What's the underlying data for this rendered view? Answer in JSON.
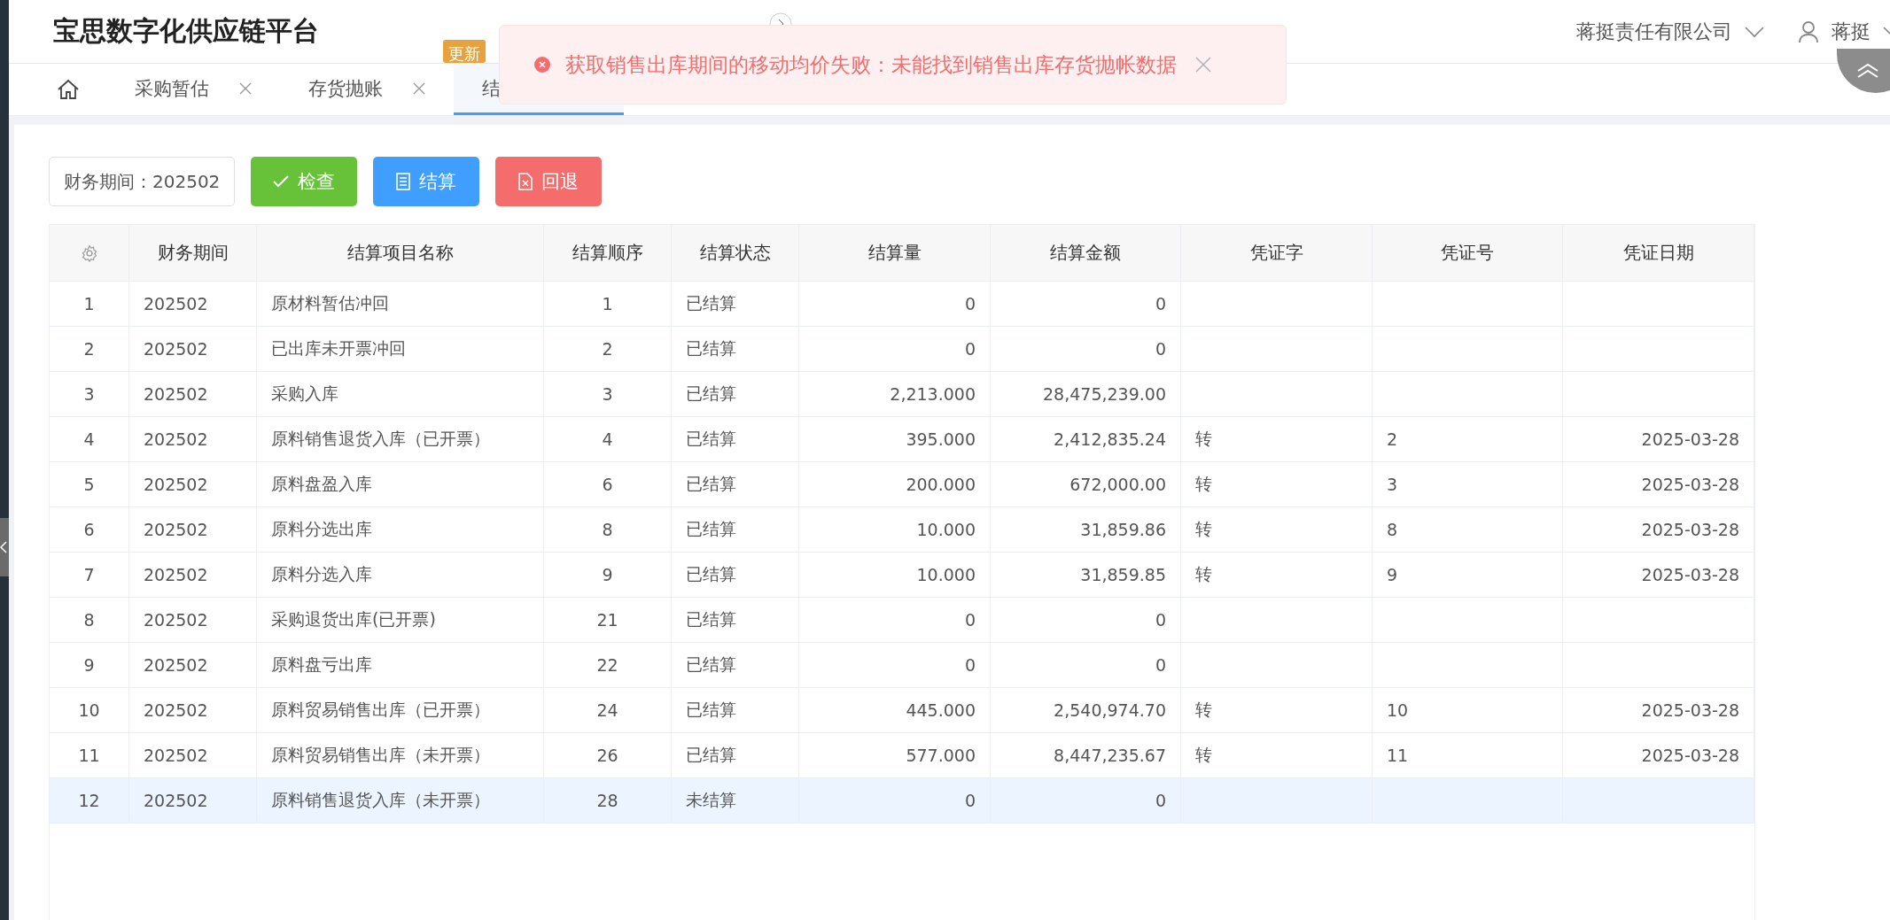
{
  "header": {
    "title": "宝思数字化供应链平台",
    "badge": "更新",
    "company": "蒋挺责任有限公司",
    "user": "蒋挺"
  },
  "tabs": [
    {
      "label": "采购暂估",
      "selected": false,
      "closable": true
    },
    {
      "label": "存货抛账",
      "selected": false,
      "closable": true
    },
    {
      "label": "结",
      "selected": true,
      "closable": false
    }
  ],
  "toast": {
    "message": "获取销售出库期间的移动均价失败：未能找到销售出库存货抛帐数据"
  },
  "toolbar": {
    "period": "财务期间：202502",
    "buttons": [
      {
        "kind": "check",
        "label": "检查"
      },
      {
        "kind": "settle",
        "label": "结算"
      },
      {
        "kind": "rollback",
        "label": "回退"
      }
    ]
  },
  "table": {
    "columns": [
      "财务期间",
      "结算项目名称",
      "结算顺序",
      "结算状态",
      "结算量",
      "结算金额",
      "凭证字",
      "凭证号",
      "凭证日期"
    ],
    "rows": [
      {
        "index": "1",
        "cells": [
          "202502",
          "原材料暂估冲回",
          "1",
          "已结算",
          "0",
          "0",
          "",
          "",
          ""
        ],
        "selected": false
      },
      {
        "index": "2",
        "cells": [
          "202502",
          "已出库未开票冲回",
          "2",
          "已结算",
          "0",
          "0",
          "",
          "",
          ""
        ],
        "selected": false
      },
      {
        "index": "3",
        "cells": [
          "202502",
          "采购入库",
          "3",
          "已结算",
          "2,213.000",
          "28,475,239.00",
          "",
          "",
          ""
        ],
        "selected": false
      },
      {
        "index": "4",
        "cells": [
          "202502",
          "原料销售退货入库（已开票）",
          "4",
          "已结算",
          "395.000",
          "2,412,835.24",
          "转",
          "2",
          "2025-03-28"
        ],
        "selected": false
      },
      {
        "index": "5",
        "cells": [
          "202502",
          "原料盘盈入库",
          "6",
          "已结算",
          "200.000",
          "672,000.00",
          "转",
          "3",
          "2025-03-28"
        ],
        "selected": false
      },
      {
        "index": "6",
        "cells": [
          "202502",
          "原料分选出库",
          "8",
          "已结算",
          "10.000",
          "31,859.86",
          "转",
          "8",
          "2025-03-28"
        ],
        "selected": false
      },
      {
        "index": "7",
        "cells": [
          "202502",
          "原料分选入库",
          "9",
          "已结算",
          "10.000",
          "31,859.85",
          "转",
          "9",
          "2025-03-28"
        ],
        "selected": false
      },
      {
        "index": "8",
        "cells": [
          "202502",
          "采购退货出库(已开票)",
          "21",
          "已结算",
          "0",
          "0",
          "",
          "",
          ""
        ],
        "selected": false
      },
      {
        "index": "9",
        "cells": [
          "202502",
          "原料盘亏出库",
          "22",
          "已结算",
          "0",
          "0",
          "",
          "",
          ""
        ],
        "selected": false
      },
      {
        "index": "10",
        "cells": [
          "202502",
          "原料贸易销售出库（已开票）",
          "24",
          "已结算",
          "445.000",
          "2,540,974.70",
          "转",
          "10",
          "2025-03-28"
        ],
        "selected": false
      },
      {
        "index": "11",
        "cells": [
          "202502",
          "原料贸易销售出库（未开票）",
          "26",
          "已结算",
          "577.000",
          "8,447,235.67",
          "转",
          "11",
          "2025-03-28"
        ],
        "selected": false
      },
      {
        "index": "12",
        "cells": [
          "202502",
          "原料销售退货入库（未开票）",
          "28",
          "未结算",
          "0",
          "0",
          "",
          "",
          ""
        ],
        "selected": true
      }
    ]
  }
}
